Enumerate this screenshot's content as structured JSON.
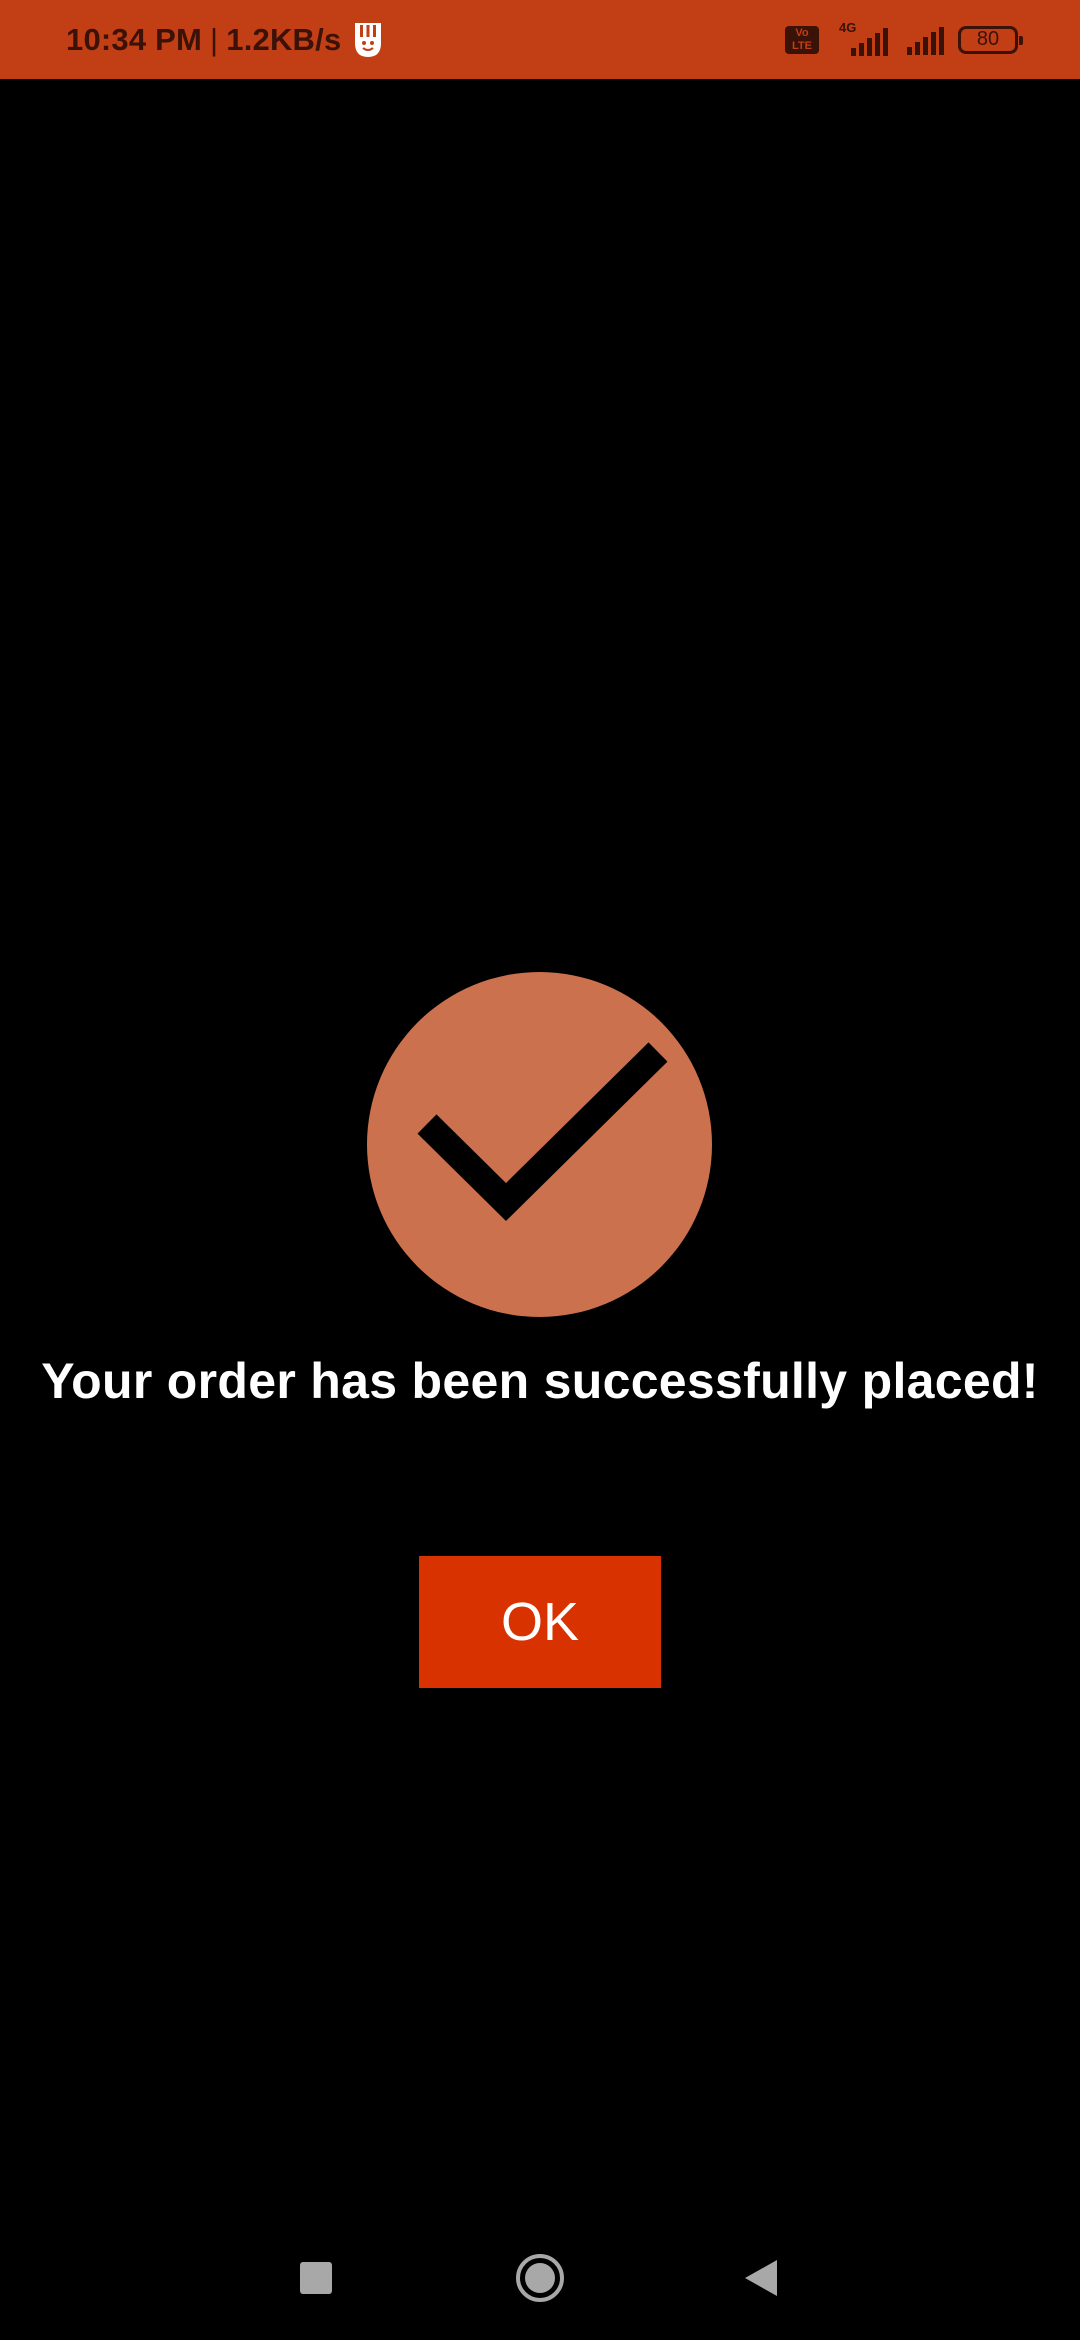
{
  "status_bar": {
    "time": "10:34 PM",
    "separator": "|",
    "net_speed": "1.2KB/s",
    "volte_label": "Vo LTE",
    "network_type": "4G",
    "battery_level": "80",
    "bg_color": "#C23E15"
  },
  "success": {
    "icon": "checkmark-circle-icon",
    "circle_color": "#CB714D",
    "message": "Your order has been successfully placed!"
  },
  "actions": {
    "ok_label": "OK",
    "ok_color": "#D83200"
  },
  "nav_bar": {
    "recents_icon": "square-icon",
    "home_icon": "circle-icon",
    "back_icon": "triangle-back-icon"
  }
}
